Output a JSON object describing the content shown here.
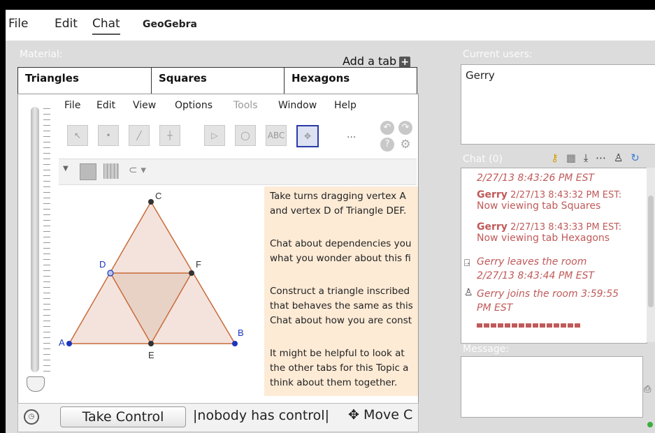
{
  "menubar": {
    "file": "File",
    "edit": "Edit",
    "chat": "Chat",
    "geogebra": "GeoGebra"
  },
  "left": {
    "panel_title": "Material:",
    "add_tab": "Add a tab",
    "tabs": [
      "Triangles",
      "Squares",
      "Hexagons"
    ],
    "geogebra_menu": [
      "File",
      "Edit",
      "View",
      "Options",
      "Tools",
      "Window",
      "Help"
    ],
    "toolbar_more": "...",
    "points": {
      "A": "A",
      "B": "B",
      "C": "C",
      "D": "D",
      "E": "E",
      "F": "F"
    },
    "instructions": [
      "Take turns dragging vertex A",
      "and vertex D of Triangle DEF.",
      "",
      "Chat about dependencies you",
      "what you wonder about this fi",
      "",
      "Construct a triangle inscribed",
      "that behaves the same as this",
      "Chat about how you are const",
      "",
      "It might be helpful to look at",
      "the other tabs for this Topic a",
      "think about them together."
    ],
    "take_control": "Take Control",
    "control_status": "|nobody has control|",
    "move_label": "Move C"
  },
  "right": {
    "users_title": "Current users:",
    "users": [
      "Gerry"
    ],
    "chat_title": "Chat (0)",
    "message_title": "Message:",
    "chat_lines": [
      {
        "kind": "time",
        "text": "2/27/13 8:43:26 PM EST"
      },
      {
        "kind": "msg",
        "user": "Gerry",
        "time": "2/27/13 8:43:32 PM EST:",
        "body": "Now viewing tab Squares"
      },
      {
        "kind": "msg",
        "user": "Gerry",
        "time": "2/27/13 8:43:33 PM EST:",
        "body": "Now viewing tab Hexagons"
      },
      {
        "kind": "event",
        "text": "Gerry leaves the room",
        "time": "2/27/13 8:43:44 PM EST"
      },
      {
        "kind": "event",
        "text": "Gerry joins the room 3:59:55",
        "time": "PM EST"
      }
    ],
    "accent": "#c05a5a"
  }
}
